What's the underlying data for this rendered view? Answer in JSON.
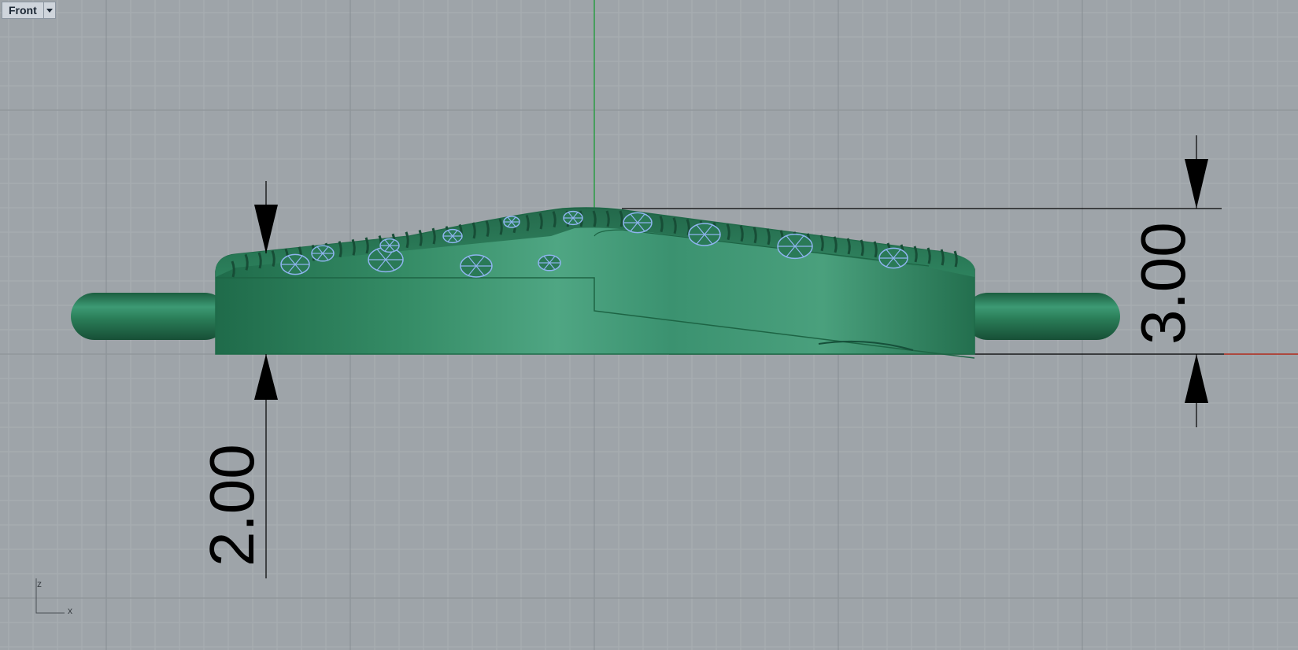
{
  "viewport": {
    "name": "Front",
    "menu_icon": "chevron-down-icon"
  },
  "dimensions": [
    {
      "id": "dim-left",
      "value": "2.00"
    },
    {
      "id": "dim-right",
      "value": "3.00"
    }
  ],
  "axis_icon": {
    "z_label": "z",
    "x_label": "x"
  },
  "colors": {
    "background": "#9ea4a9",
    "grid_minor": "#a9afb4",
    "grid_major": "#8e9499",
    "x_axis": "#c0392b",
    "z_axis": "#2e9e48",
    "model": "#2f8a63",
    "stones": "#8fb4f0",
    "dimension": "#000000"
  }
}
